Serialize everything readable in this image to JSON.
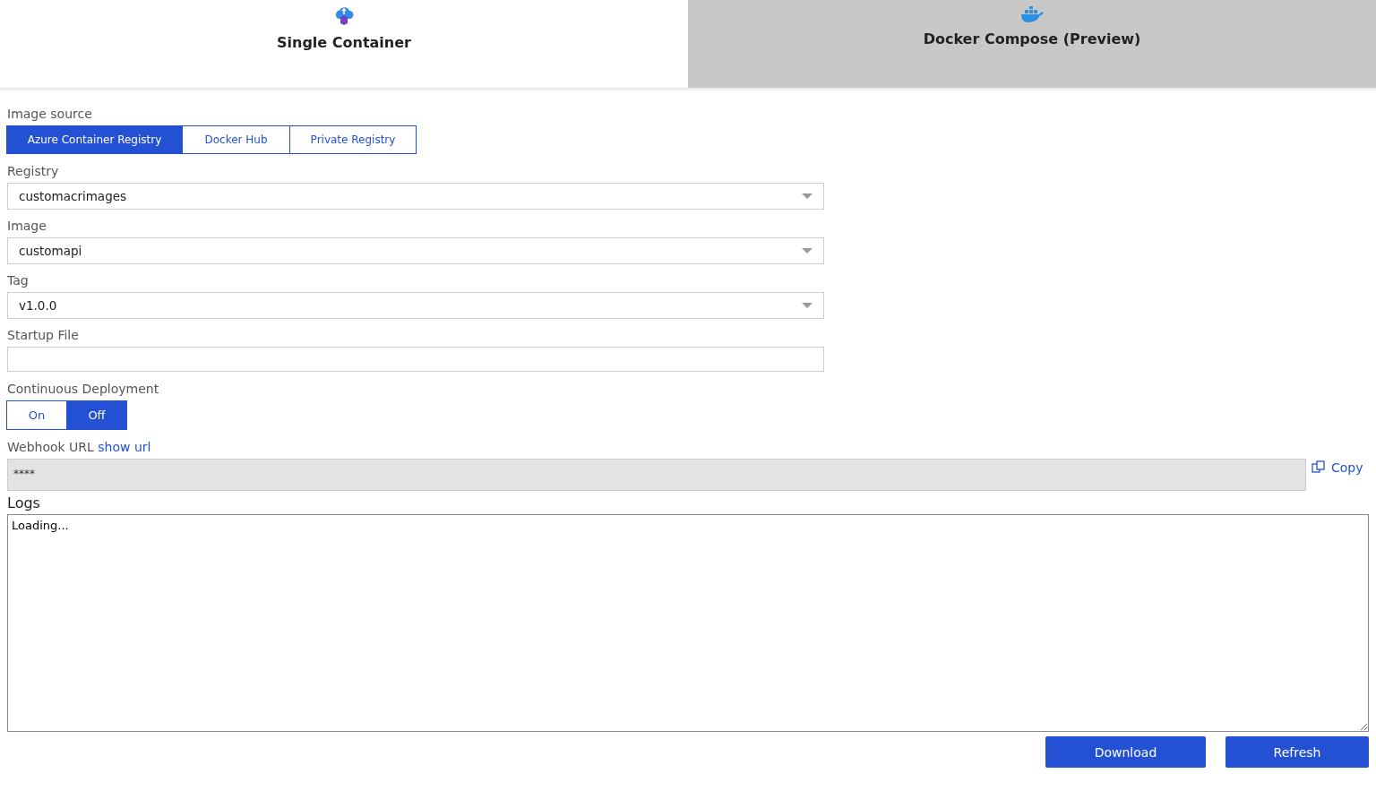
{
  "tabs": [
    {
      "label": "Single Container",
      "kind": "container",
      "selected": true
    },
    {
      "label": "Docker Compose (Preview)",
      "kind": "docker",
      "selected": false
    }
  ],
  "image_source": {
    "label": "Image source",
    "options": [
      {
        "label": "Azure Container Registry",
        "selected": true
      },
      {
        "label": "Docker Hub",
        "selected": false
      },
      {
        "label": "Private Registry",
        "selected": false
      }
    ]
  },
  "fields": [
    {
      "label": "Registry",
      "kind": "dropdown",
      "value": "customacrimages"
    },
    {
      "label": "Image",
      "kind": "dropdown",
      "value": "customapi"
    },
    {
      "label": "Tag",
      "kind": "dropdown",
      "value": "v1.0.0"
    },
    {
      "label": "Startup File",
      "kind": "text"
    }
  ],
  "continuous_deployment": {
    "label": "Continuous Deployment",
    "options": [
      {
        "label": "On",
        "selected": false
      },
      {
        "label": "Off",
        "selected": true
      }
    ]
  },
  "webhook": {
    "label": "Webhook URL",
    "link": "show url",
    "value": "****",
    "copy": "Copy"
  },
  "logs": {
    "label": "Logs",
    "value": "Loading..."
  },
  "buttons": [
    "Download",
    "Refresh"
  ]
}
